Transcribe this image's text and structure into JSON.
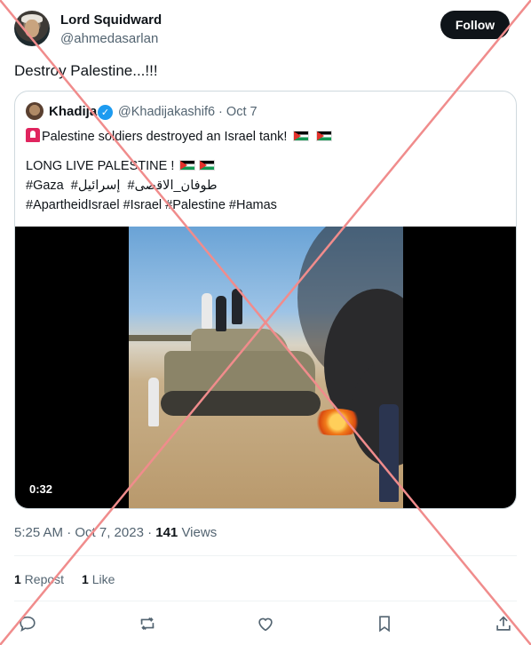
{
  "author": {
    "display_name": "Lord Squidward",
    "handle": "@ahmedasarlan"
  },
  "follow_label": "Follow",
  "tweet_text": "Destroy Palestine...!!!",
  "quoted": {
    "name": "Khadija",
    "handle_date": "@Khadijakashif6 · Oct 7",
    "line1": "Palestine soldiers destroyed an Israel tank!",
    "line2": "LONG LIVE PALESTINE !",
    "line3_a": "#Gaza",
    "line3_b": "طوفان_الاقصى#",
    "line3_c": "إسرائيل#",
    "line4": "#ApartheidIsrael #Israel #Palestine #Hamas",
    "video_duration": "0:32"
  },
  "meta": {
    "timestamp": "5:25 AM · Oct 7, 2023 · ",
    "views_count": "141",
    "views_label": " Views"
  },
  "stats": {
    "reposts_count": "1",
    "reposts_label": " Repost",
    "likes_count": "1",
    "likes_label": " Like"
  },
  "icons": [
    "reply-icon",
    "repost-icon",
    "like-icon",
    "bookmark-icon",
    "share-icon",
    "verified-icon"
  ],
  "colors": {
    "accent": "#1d9bf0",
    "cross_overlay": "#f08c8c"
  }
}
